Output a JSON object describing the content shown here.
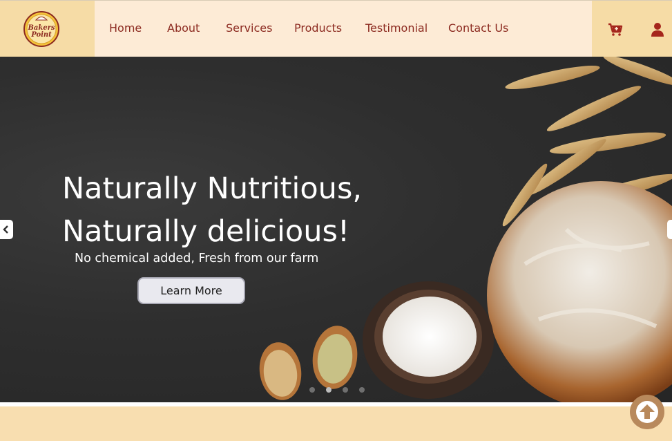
{
  "brand": {
    "logo_text_1": "Bakers",
    "logo_text_2": "Point"
  },
  "nav": {
    "items": [
      {
        "label": "Home"
      },
      {
        "label": "About"
      },
      {
        "label": "Services"
      },
      {
        "label": "Products"
      },
      {
        "label": "Testimonial"
      },
      {
        "label": "Contact Us"
      }
    ]
  },
  "header_icons": {
    "cart": "cart-plus-icon",
    "user": "user-icon"
  },
  "hero": {
    "title_line1": "Naturally Nutritious,",
    "title_line2": "Naturally delicious!",
    "subtitle": "No chemical added, Fresh from our farm",
    "button_label": "Learn More"
  },
  "carousel": {
    "slides": 4,
    "active_index": 1
  },
  "colors": {
    "nav_text": "#8c2a20",
    "header_bg": "#fdebd6",
    "side_bg": "#f6dca6",
    "scroll_top": "#b8895c"
  }
}
